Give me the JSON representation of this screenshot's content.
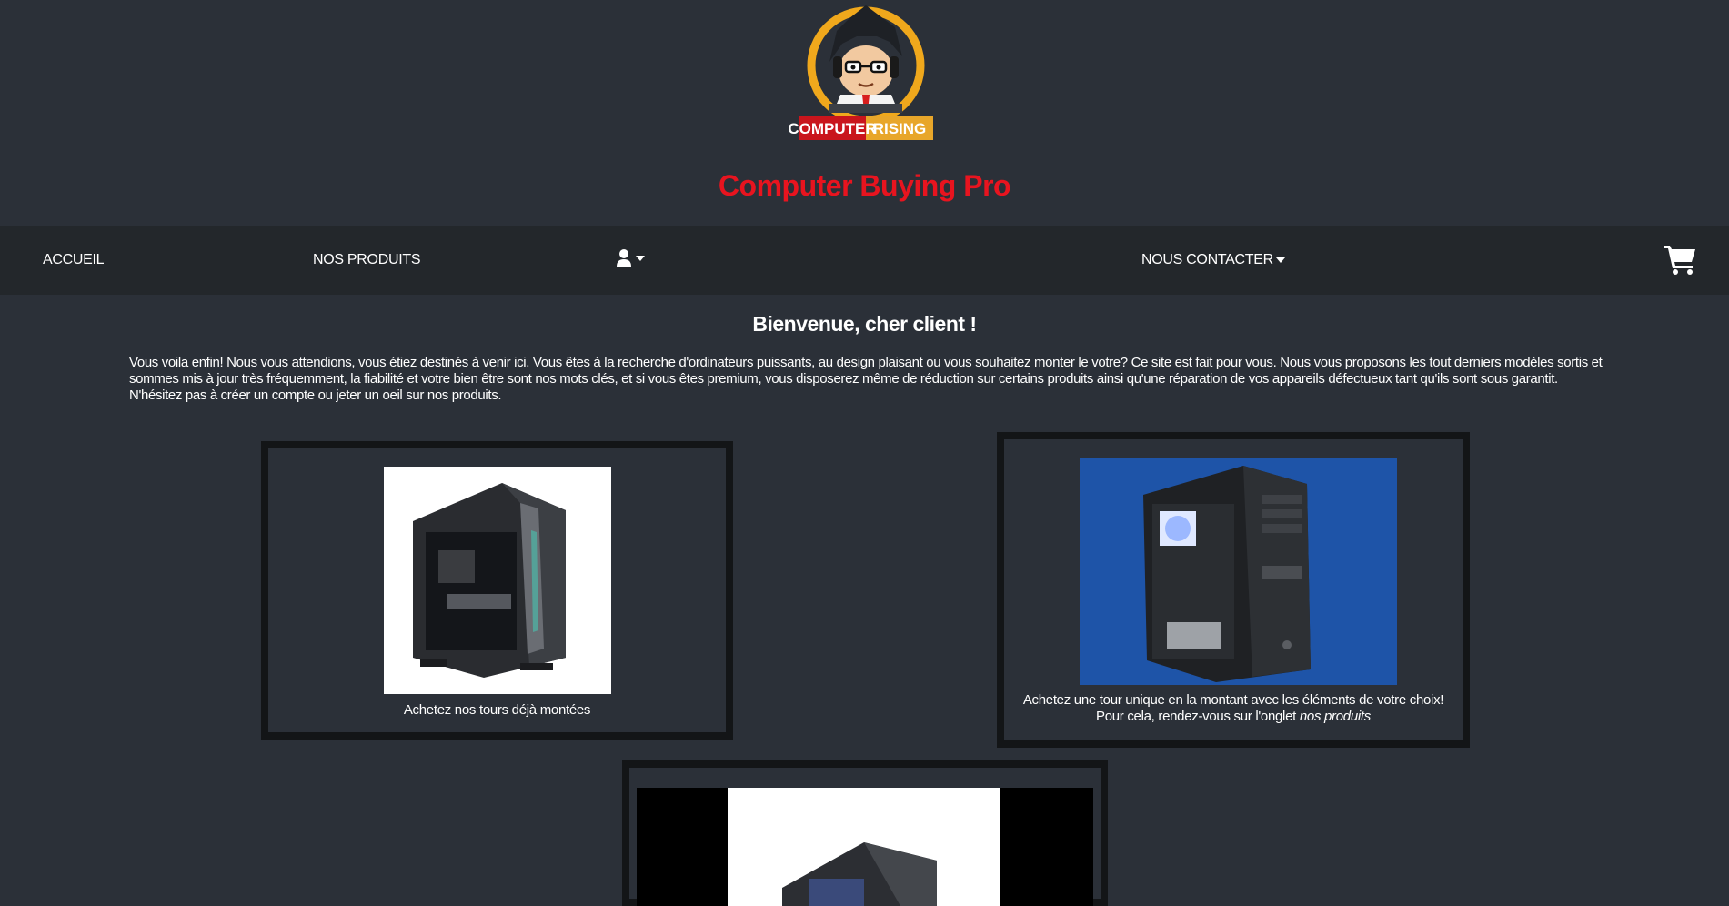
{
  "header": {
    "logo_text_left": "COMPUTER",
    "logo_text_right": "RISING",
    "site_title": "Computer Buying Pro"
  },
  "navbar": {
    "home_label": "ACCUEIL",
    "products_label": "NOS PRODUITS",
    "account_icon": "user-icon",
    "contact_label": "NOUS CONTACTER",
    "cart_icon": "shopping-cart-icon"
  },
  "main": {
    "welcome_title": "Bienvenue, cher client !",
    "intro_text": "Vous voila enfin! Nous vous attendions, vous étiez destinés à venir ici. Vous êtes à la recherche d'ordinateurs puissants, au design plaisant ou vous souhaitez monter le votre? Ce site est fait pour vous. Nous vous proposons les tout derniers modèles sortis et sommes mis à jour très fréquemment, la fiabilité et votre bien être sont nos mots clés, et si vous êtes premium, vous disposerez même de réduction sur certains produits ainsi qu'une réparation de vos appareils défectueux tant qu'ils sont sous garantit. N'hésitez pas à créer un compte ou jeter un oeil sur nos produits.",
    "cards": [
      {
        "caption": "Achetez nos tours déjà montées"
      },
      {
        "caption_line1": "Achetez une tour unique en la montant avec les éléments de votre choix!",
        "caption_line2_prefix": "Pour cela, rendez-vous sur l'onglet ",
        "caption_line2_em": "nos produits"
      },
      {
        "caption": ""
      }
    ]
  },
  "colors": {
    "background": "#2b3038",
    "navbar": "#23272b",
    "title_red": "#e8141f",
    "card_border": "#131517"
  }
}
